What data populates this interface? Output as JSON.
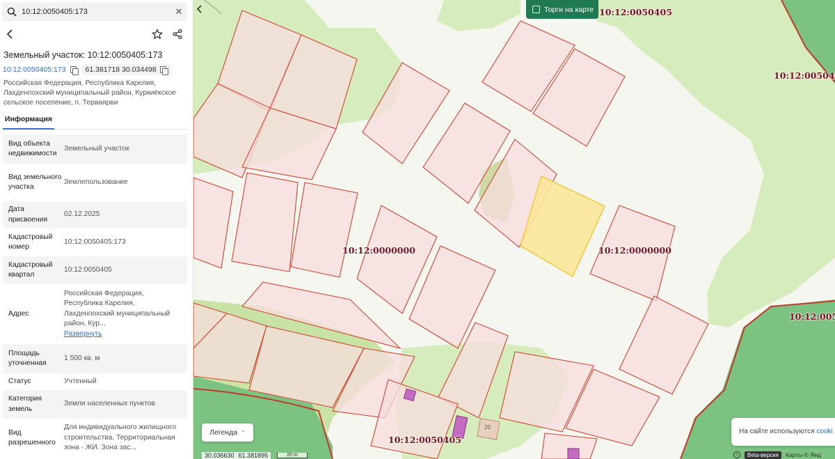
{
  "search": {
    "value": "10:12:0050405:173"
  },
  "object": {
    "title": "Земельный участок: 10:12:0050405:173",
    "cadastral_link": "10:12:0050405:173",
    "coordinates_chip": "61.381718 30.034498",
    "address": "Российская Федерация, Республика Карелия, Лахденпохский муниципальный район, Куркиёкское сельское поселение, п. Терваярви"
  },
  "tabs": [
    "Информация"
  ],
  "info_rows": [
    {
      "key": "Вид объекта недвижимости",
      "value": "Земельный участок"
    },
    {
      "key": "Вид земельного участка",
      "value": "Землепользование"
    },
    {
      "key": "Дата присвоения",
      "value": "02.12.2025"
    },
    {
      "key": "Кадастровый номер",
      "value": "10:12:0050405:173"
    },
    {
      "key": "Кадастровый квартал",
      "value": "10:12:0050405"
    },
    {
      "key": "Адрес",
      "value": "Российская Федерация, Республика Карелия, Лахденпохский муниципальный район, Кур...",
      "link": "Развернуть"
    },
    {
      "key": "Площадь уточненная",
      "value": "1 500 кв. м"
    },
    {
      "key": "Статус",
      "value": "Учтенный"
    },
    {
      "key": "Категория земель",
      "value": "Земли населенных пунктов"
    },
    {
      "key": "Вид разрешенного",
      "value": "Для индивидуального жилищного строительства. Территориальная зона - ЖИ. Зона зас..."
    }
  ],
  "map": {
    "torgi_label": "Торги на карте",
    "legend_label": "Легенда",
    "cookie_text": "На сайте используются",
    "cookie_link": "cooki",
    "coord_lat": "30.036630",
    "coord_lon": "61.381895",
    "scale": "20 m",
    "beta": "Beta-версия",
    "attribution": "Карты © Янд",
    "house_number": "20",
    "labels": [
      "10:12:0050405",
      "10:12:005040",
      "10:12:0000000",
      "10:12:0000000",
      "10:12:00504",
      "10:12:0050405"
    ],
    "colors": {
      "parcel_fill": "#f7dede",
      "parcel_stroke": "#d2452f",
      "selected_fill": "#fbe79a",
      "selected_stroke": "#f0c93c",
      "green": "#d6ecbc",
      "forest": "#7cc382",
      "torgi_bg": "#1f7a52"
    }
  }
}
